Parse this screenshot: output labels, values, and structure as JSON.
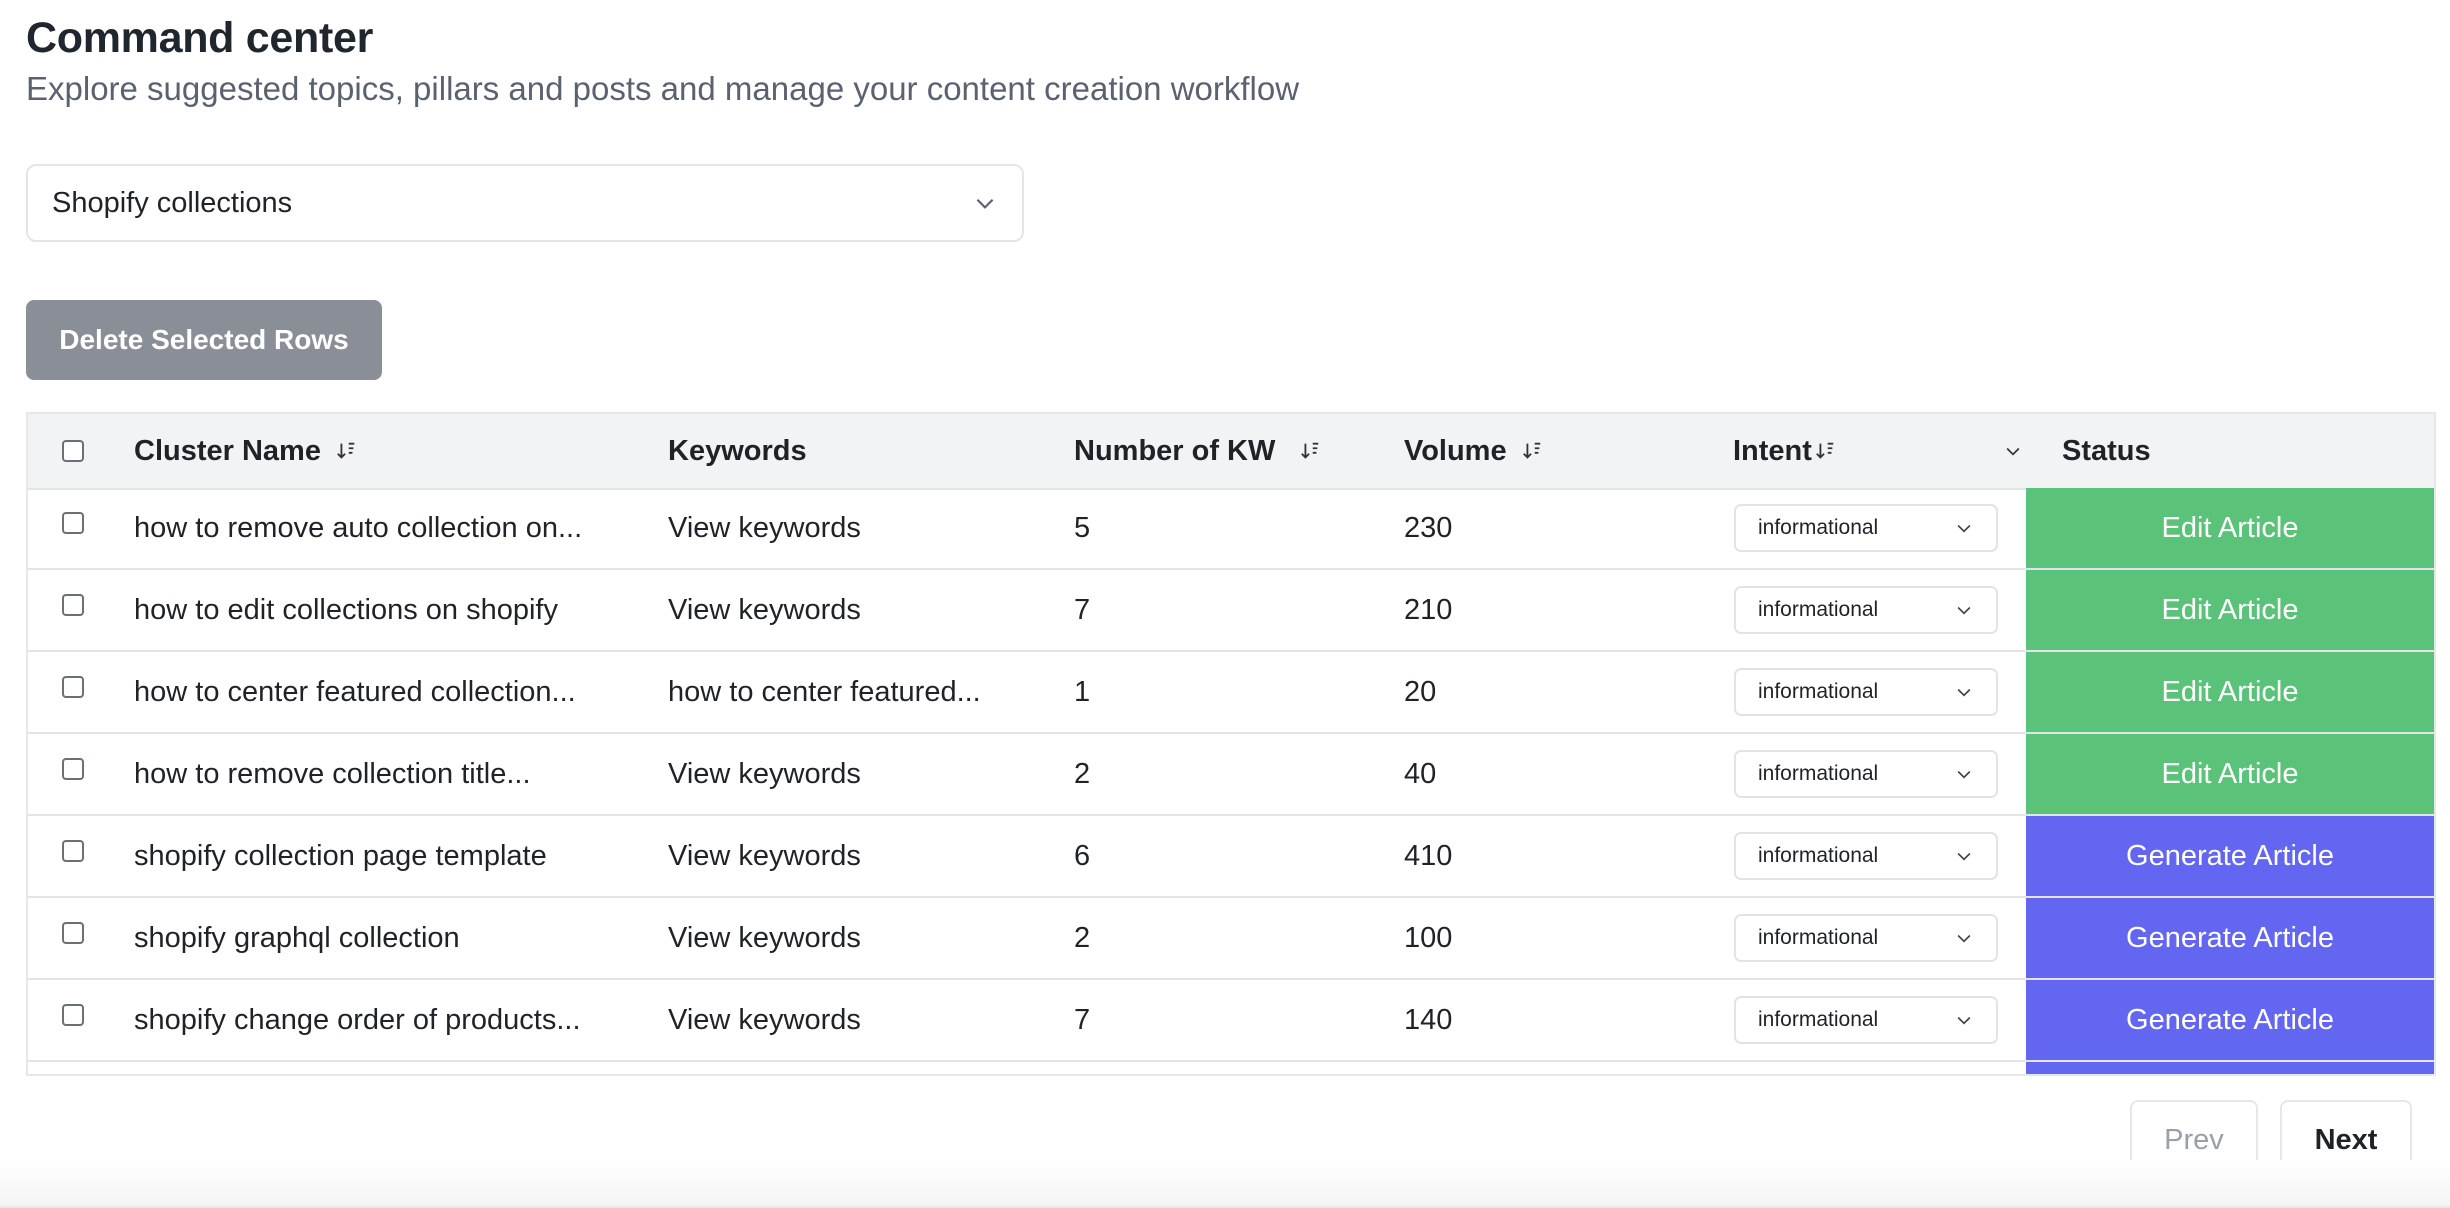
{
  "header": {
    "title": "Command center",
    "subtitle": "Explore suggested topics, pillars and posts and manage your content creation workflow"
  },
  "project_select": {
    "value": "Shopify collections"
  },
  "delete_button": {
    "label": "Delete Selected Rows"
  },
  "table": {
    "columns": {
      "cluster_name": "Cluster Name",
      "keywords": "Keywords",
      "number_of_kw": "Number of KW",
      "volume": "Volume",
      "intent": "Intent",
      "status": "Status"
    },
    "rows": [
      {
        "cluster": "how to remove auto collection on...",
        "keywords": "View keywords",
        "num_kw": "5",
        "volume": "230",
        "intent": "informational",
        "status": "Edit Article",
        "status_type": "edit"
      },
      {
        "cluster": "how to edit collections on shopify",
        "keywords": "View keywords",
        "num_kw": "7",
        "volume": "210",
        "intent": "informational",
        "status": "Edit Article",
        "status_type": "edit"
      },
      {
        "cluster": "how to center featured collection...",
        "keywords": "how to center featured...",
        "num_kw": "1",
        "volume": "20",
        "intent": "informational",
        "status": "Edit Article",
        "status_type": "edit"
      },
      {
        "cluster": "how to remove collection title...",
        "keywords": "View keywords",
        "num_kw": "2",
        "volume": "40",
        "intent": "informational",
        "status": "Edit Article",
        "status_type": "edit"
      },
      {
        "cluster": "shopify collection page template",
        "keywords": "View keywords",
        "num_kw": "6",
        "volume": "410",
        "intent": "informational",
        "status": "Generate Article",
        "status_type": "generate"
      },
      {
        "cluster": "shopify graphql collection",
        "keywords": "View keywords",
        "num_kw": "2",
        "volume": "100",
        "intent": "informational",
        "status": "Generate Article",
        "status_type": "generate"
      },
      {
        "cluster": "shopify change order of products...",
        "keywords": "View keywords",
        "num_kw": "7",
        "volume": "140",
        "intent": "informational",
        "status": "Generate Article",
        "status_type": "generate"
      }
    ]
  },
  "pagination": {
    "prev": "Prev",
    "next": "Next"
  },
  "colors": {
    "edit": "#5bc27a",
    "generate": "#6366f1",
    "disabled_button": "#8a8e96"
  }
}
